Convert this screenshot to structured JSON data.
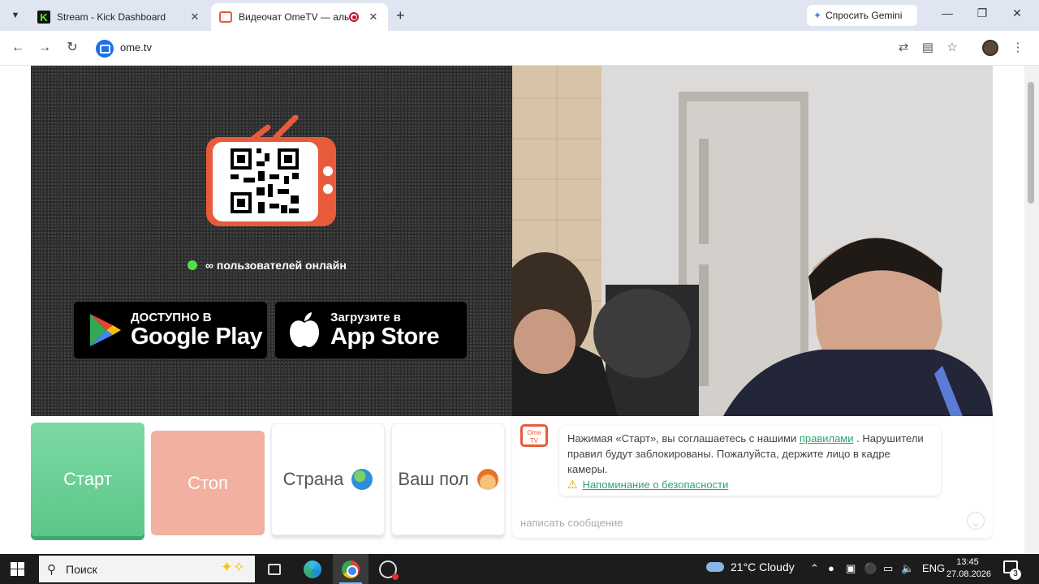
{
  "tabs": [
    {
      "title": "Stream - Kick Dashboard",
      "favicon": "kick-icon"
    },
    {
      "title": "Видеочат OmeTV — альте",
      "favicon": "ometv-icon",
      "recording": true
    }
  ],
  "browser": {
    "gemini_label": "Спросить Gemini",
    "url": "ome.tv"
  },
  "ometv": {
    "online_text": "∞ пользователей онлайн",
    "google_play_small": "ДОСТУПНО В",
    "google_play_big": "Google Play",
    "app_store_small": "Загрузите в",
    "app_store_big": "App Store",
    "buttons": {
      "start": "Старт",
      "stop": "Стоп",
      "country": "Страна",
      "gender": "Ваш пол"
    },
    "chat": {
      "avatar_text": "Ome TV",
      "message_before": "Нажимая «Старт», вы соглашаетесь с нашими ",
      "rules_link": "правилами",
      "message_after": " . Нарушители правил будут заблокированы. Пожалуйста, держите лицо в кадре камеры.",
      "safety_link": "Напоминание о безопасности",
      "input_placeholder": "написать сообщение"
    }
  },
  "taskbar": {
    "search_placeholder": "Поиск",
    "weather": "21°C Cloudy",
    "language": "ENG",
    "time": "13:45",
    "date": "27.08.2026",
    "notification_count": "3"
  },
  "colors": {
    "ometv_orange": "#e85b3a",
    "start_green": "#6fd09a",
    "stop_salmon": "#f1b0a0",
    "link_green": "#2aa56e",
    "online_green": "#52e04a"
  }
}
